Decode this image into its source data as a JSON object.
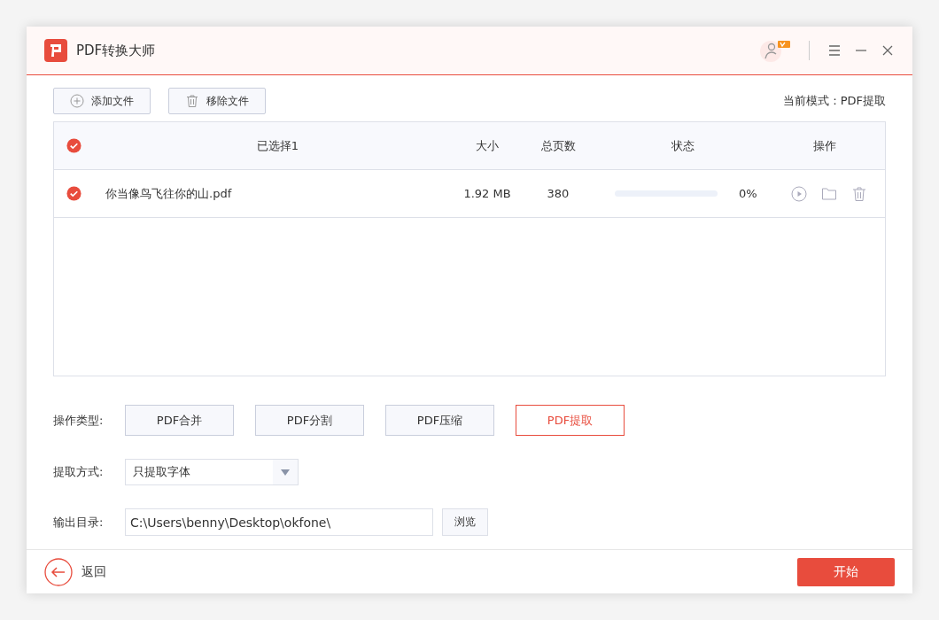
{
  "window": {
    "title": "PDF转换大师"
  },
  "toolbar": {
    "buttons": [
      {
        "kind": "add",
        "label": "添加文件"
      },
      {
        "kind": "remove",
        "label": "移除文件"
      }
    ],
    "mode": "当前模式：PDF提取"
  },
  "table": {
    "all_checked": true,
    "columns": [
      "已选择1",
      "大小",
      "总页数",
      "状态",
      "操作"
    ],
    "rows": [
      {
        "checked": true,
        "name": "你当像鸟飞往你的山.pdf",
        "size": "1.92 MB",
        "pages": "380",
        "level": 0,
        "progress": "0%"
      }
    ]
  },
  "operation": {
    "label": "操作类型:",
    "types": [
      {
        "label": "PDF合并",
        "selected": false
      },
      {
        "label": "PDF分割",
        "selected": false
      },
      {
        "label": "PDF压缩",
        "selected": false
      },
      {
        "label": "PDF提取",
        "selected": true
      }
    ]
  },
  "extract": {
    "label": "提取方式:",
    "value": "只提取字体"
  },
  "output": {
    "label": "输出目录:",
    "value": "C:\\Users\\benny\\Desktop\\okfone\\",
    "browse": "浏览"
  },
  "footer": {
    "back": "返回",
    "start": "开始"
  }
}
